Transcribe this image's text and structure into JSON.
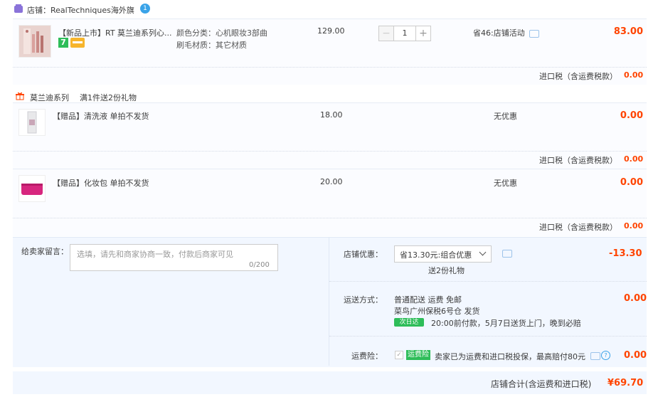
{
  "store": {
    "label": "店铺：RealTechniques海外旗",
    "badge": "1"
  },
  "main_item": {
    "name": "【新品上市】RT 莫兰迪系列心...",
    "sku_color": "颜色分类：心机眼妆3部曲",
    "sku_material": "刷毛材质：其它材质",
    "badge_7": "7",
    "price": "129.00",
    "quantity": "1",
    "minus": "−",
    "plus": "+",
    "promo": "省46:店铺活动",
    "total": "83.00",
    "tax_label": "进口税（含运费税款）",
    "tax_value": "0.00"
  },
  "gift_group": {
    "series": "莫兰迪系列",
    "rule": "满1件送2份礼物"
  },
  "gift_items": [
    {
      "name": "【赠品】清洗液 单拍不发货",
      "price": "18.00",
      "promo": "无优惠",
      "total": "0.00",
      "tax_label": "进口税（含运费税款）",
      "tax_value": "0.00"
    },
    {
      "name": "【赠品】化妆包 单拍不发货",
      "price": "20.00",
      "promo": "无优惠",
      "total": "0.00",
      "tax_label": "进口税（含运费税款）",
      "tax_value": "0.00"
    }
  ],
  "message": {
    "label": "给卖家留言：",
    "placeholder": "选填，请先和商家协商一致，付款后商家可见",
    "counter": "0/200"
  },
  "store_discount": {
    "label": "店铺优惠：",
    "selected": "省13.30元:组合优惠",
    "note": "送2份礼物",
    "value": "-13.30"
  },
  "shipping": {
    "label": "运送方式：",
    "line1": "普通配送 运费 免邮",
    "line2": "菜鸟广州保税6号仓  发货",
    "nextday": "次日达",
    "line3": "20:00前付款，5月7日送货上门，晚到必赔",
    "value": "0.00"
  },
  "insurance": {
    "label": "运费险：",
    "tag": "运费险",
    "text": "卖家已为运费和进口税投保，最高赔付80元",
    "help": "?",
    "value": "0.00"
  },
  "summary": {
    "label": "店铺合计(含运费和进口税)",
    "value": "¥69.70"
  },
  "colors": {
    "accent_price": "#ff4400",
    "green_tag": "#2ebd59",
    "store_icon": "#8a73d9"
  }
}
